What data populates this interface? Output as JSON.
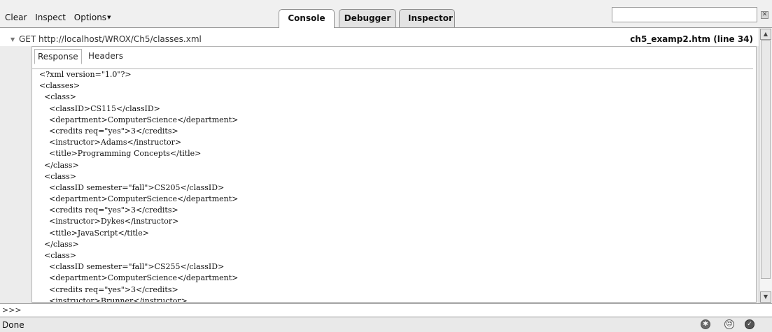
{
  "toolbar": {
    "clear_label": "Clear",
    "inspect_label": "Inspect",
    "options_label": "Options",
    "tabs": [
      {
        "label": "Console",
        "active": true
      },
      {
        "label": "Debugger",
        "active": false
      },
      {
        "label": "Inspector",
        "active": false
      }
    ],
    "search_value": ""
  },
  "request": {
    "method_url": "GET http://localhost/WROX/Ch5/classes.xml",
    "source": "ch5_examp2.htm (line 34)"
  },
  "response": {
    "subtabs": [
      {
        "label": "Response",
        "active": true
      },
      {
        "label": "Headers",
        "active": false
      }
    ],
    "lines": [
      "<?xml version=\"1.0\"?>",
      "<classes>",
      "  <class>",
      "    <classID>CS115</classID>",
      "    <department>ComputerScience</department>",
      "    <credits req=\"yes\">3</credits>",
      "    <instructor>Adams</instructor>",
      "    <title>Programming Concepts</title>",
      "  </class>",
      "  <class>",
      "    <classID semester=\"fall\">CS205</classID>",
      "    <department>ComputerScience</department>",
      "    <credits req=\"yes\">3</credits>",
      "    <instructor>Dykes</instructor>",
      "    <title>JavaScript</title>",
      "  </class>",
      "  <class>",
      "    <classID semester=\"fall\">CS255</classID>",
      "    <department>ComputerScience</department>",
      "    <credits req=\"yes\">3</credits>",
      "    <instructor>Brunner</instructor>"
    ]
  },
  "command_line": {
    "prompt": ">>>",
    "value": ""
  },
  "status": {
    "text": "Done",
    "icons": [
      "bug-icon",
      "face-icon",
      "check-icon"
    ]
  },
  "colors": {
    "toolbar_bg": "#f0f0f0",
    "panel_border": "#b5b5b5",
    "active_tab_bg": "#ffffff"
  }
}
